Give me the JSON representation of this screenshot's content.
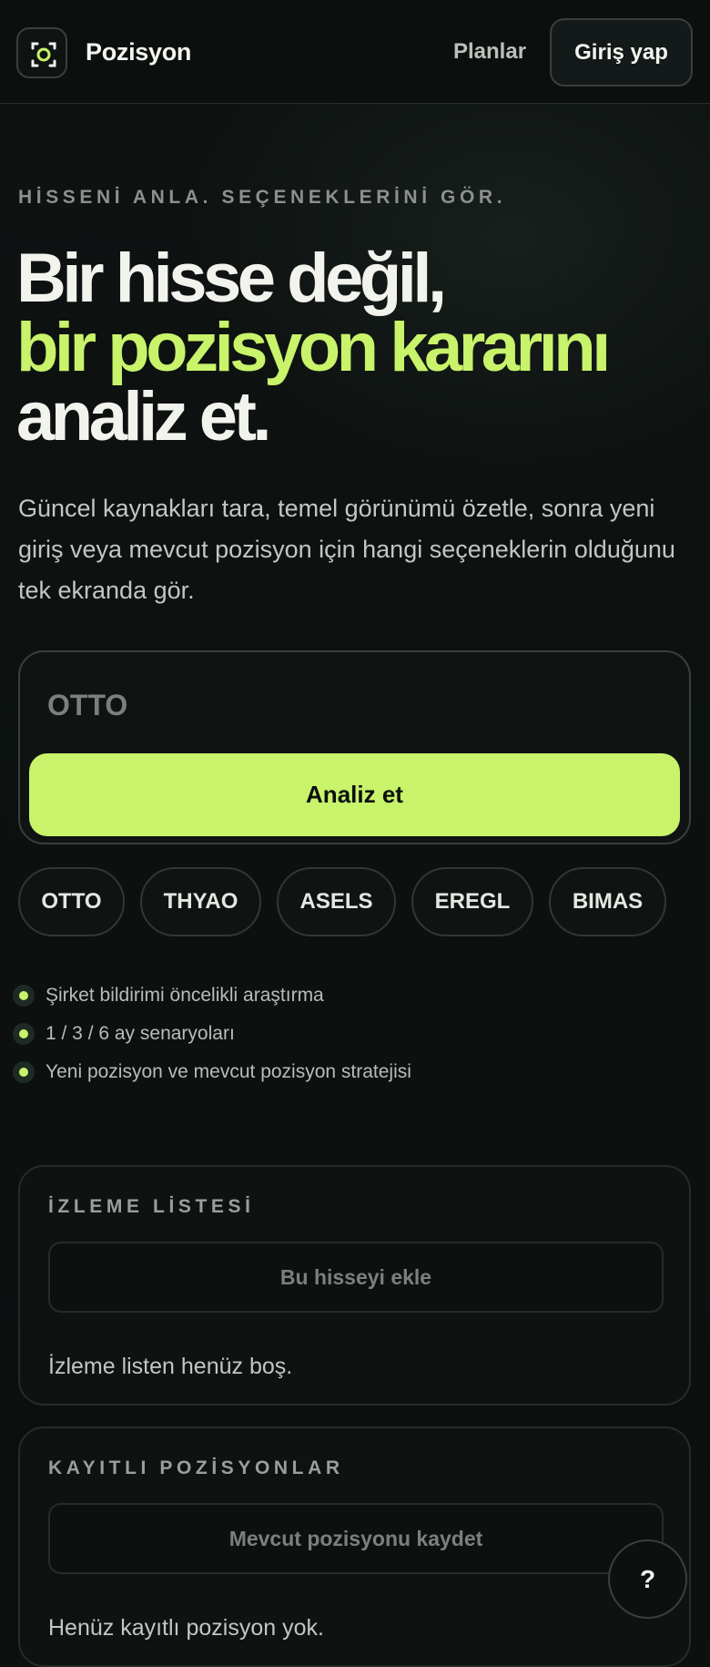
{
  "header": {
    "brand": "Pozisyon",
    "logo_icon": "focus-target-icon",
    "nav_plans": "Planlar",
    "login": "Giriş yap"
  },
  "hero": {
    "eyebrow": "HİSSENİ ANLA. SEÇENEKLERİNİ GÖR.",
    "headline_line1": "Bir hisse değil,",
    "headline_line2": "bir pozisyon kararını",
    "headline_line3": "analiz et.",
    "lead": "Güncel kaynakları tara, temel görünümü özetle, sonra yeni giriş veya mevcut pozisyon için hangi seçeneklerin olduğunu tek ekranda gör."
  },
  "search": {
    "placeholder": "OTTO",
    "value": "",
    "analyze_label": "Analiz et"
  },
  "chips": [
    "OTTO",
    "THYAO",
    "ASELS",
    "EREGL",
    "BIMAS"
  ],
  "features": [
    "Şirket bildirimi öncelikli araştırma",
    "1 / 3 / 6 ay senaryoları",
    "Yeni pozisyon ve mevcut pozisyon stratejisi"
  ],
  "watchlist": {
    "title": "İZLEME LİSTESİ",
    "add_label": "Bu hisseyi ekle",
    "empty": "İzleme listen henüz boş."
  },
  "positions": {
    "title": "KAYITLI POZİSYONLAR",
    "save_label": "Mevcut pozisyonu kaydet",
    "empty": "Henüz kayıtlı pozisyon yok."
  },
  "help": {
    "label": "?"
  },
  "colors": {
    "accent": "#c8f36a",
    "background": "#0c1110",
    "border": "#3a403d"
  }
}
